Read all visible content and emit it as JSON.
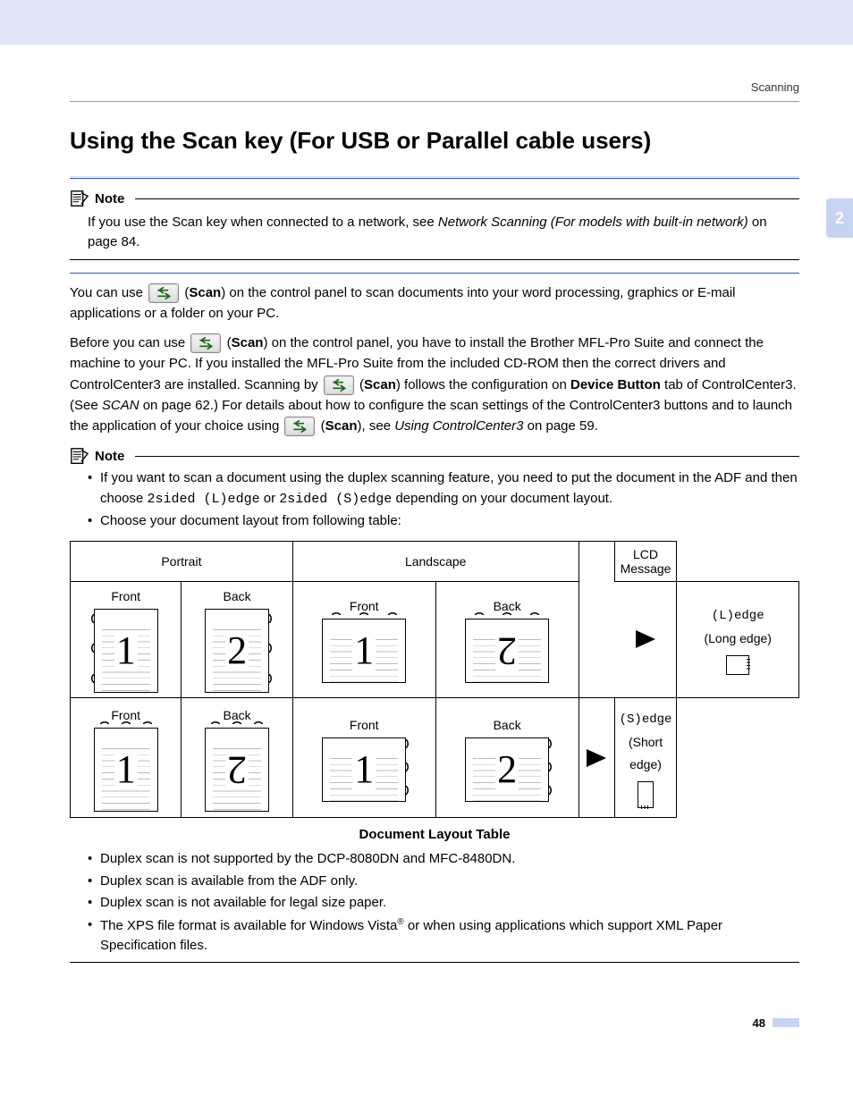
{
  "header": {
    "section": "Scanning",
    "chapter": "2",
    "page_number": "48"
  },
  "title": "Using the Scan key (For USB or Parallel cable users)",
  "note1": {
    "label": "Note",
    "p1a": "If you use the Scan key when connected to a network, see ",
    "p1b": "Network Scanning (For models with built-in network)",
    "p1c": " on page 84."
  },
  "para1": {
    "a": "You can use ",
    "b": " (",
    "c": "Scan",
    "d": ") on the control panel to scan documents into your word processing, graphics or E-mail applications or a folder on your PC."
  },
  "para2": {
    "a": "Before you can use ",
    "b": " (",
    "c": "Scan",
    "d": ") on the control panel, you have to install the Brother MFL-Pro Suite and connect the machine to your PC. If you installed the MFL-Pro Suite from the included CD-ROM then the correct drivers and ControlCenter3 are installed. Scanning by ",
    "e": " (",
    "f": "Scan",
    "g": ") follows the configuration on ",
    "h": "Device Button",
    "i": " tab of ControlCenter3. (See ",
    "j": "SCAN",
    "k": " on page 62.) For details about how to configure the scan settings of the ControlCenter3 buttons and to launch the application of your choice using ",
    "l": " (",
    "m": "Scan",
    "n": "), see ",
    "o": "Using ControlCenter3",
    "p": " on page 59."
  },
  "note2": {
    "label": "Note",
    "b1a": "If you want to scan a document using the duplex scanning feature, you need to put the document in the ADF and then choose ",
    "b1b": "2sided (L)edge",
    "b1c": " or ",
    "b1d": "2sided (S)edge",
    "b1e": " depending on your document layout.",
    "b2": "Choose your document layout from following table:"
  },
  "table": {
    "h_portrait": "Portrait",
    "h_landscape": "Landscape",
    "h_lcd": "LCD Message",
    "front": "Front",
    "back": "Back",
    "ledge_code": "(L)edge",
    "ledge_label": "(Long edge)",
    "sedge_code": "(S)edge",
    "sedge_label": "(Short edge)",
    "caption": "Document Layout Table"
  },
  "bullets": {
    "b1": "Duplex scan is not supported by the DCP-8080DN and MFC-8480DN.",
    "b2": "Duplex scan is available from the ADF only.",
    "b3": "Duplex scan is not available for legal size paper.",
    "b4a": "The XPS file format is available for Windows Vista",
    "b4b": " or when using applications which support XML Paper Specification files."
  }
}
